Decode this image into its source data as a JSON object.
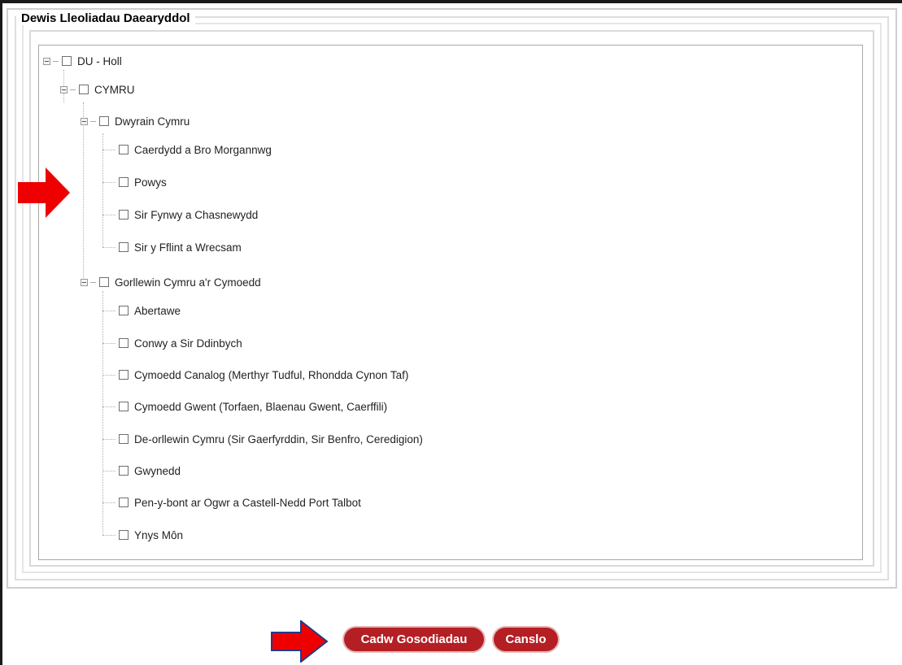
{
  "section": {
    "legend": "Dewis Lleoliadau Daearyddol"
  },
  "tree": {
    "root": "DU - Holl",
    "country": "CYMRU",
    "groups": [
      {
        "label": "Dwyrain Cymru",
        "items": [
          "Caerdydd a Bro Morgannwg",
          "Powys",
          "Sir Fynwy a Chasnewydd",
          "Sir y Fflint a Wrecsam"
        ]
      },
      {
        "label": "Gorllewin Cymru a'r Cymoedd",
        "items": [
          "Abertawe",
          "Conwy a Sir Ddinbych",
          "Cymoedd Canalog (Merthyr Tudful, Rhondda Cynon Taf)",
          "Cymoedd Gwent (Torfaen, Blaenau Gwent, Caerffili)",
          "De-orllewin Cymru (Sir Gaerfyrddin, Sir Benfro, Ceredigion)",
          "Gwynedd",
          "Pen-y-bont ar Ogwr a Castell-Nedd Port Talbot",
          "Ynys Môn"
        ]
      }
    ]
  },
  "buttons": {
    "save": "Cadw Gosodiadau",
    "cancel": "Canslo"
  },
  "colors": {
    "button_bg": "#b41f24",
    "arrow": "#ee0000"
  }
}
